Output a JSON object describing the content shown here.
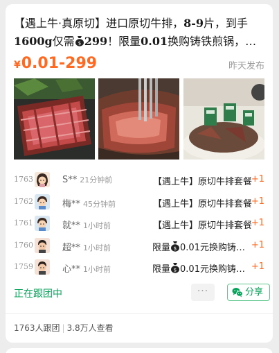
{
  "product": {
    "title_prefix": "【遇上牛·真原切】进口原切牛排，",
    "title_bold1": "8-9",
    "title_mid1": "片，到手",
    "title_bold2": "1600g",
    "title_mid2": "仅需",
    "title_bold3": "299",
    "title_mid3": "！限量",
    "title_bold4": "0.01",
    "title_suffix": "换购铸铁煎锅，…",
    "price_symbol": "¥",
    "price_range": "0.01-299",
    "posted": "昨天发布",
    "photos": [
      "steak-slices-photo",
      "steak-fork-photo",
      "steak-packages-photo"
    ]
  },
  "feed": [
    {
      "seq": "1763",
      "user": "S**",
      "time": "21分钟前",
      "item": "【遇上牛】原切牛排套餐",
      "qty": "+1",
      "avatar": "girl"
    },
    {
      "seq": "1762",
      "user": "梅**",
      "time": "45分钟前",
      "item": "【遇上牛】原切牛排套餐",
      "qty": "+1",
      "avatar": "boy"
    },
    {
      "seq": "1761",
      "user": "就**",
      "time": "1小时前",
      "item": "【遇上牛】原切牛排套餐",
      "qty": "+1",
      "avatar": "boy"
    },
    {
      "seq": "1760",
      "user": "超**",
      "time": "1小时前",
      "item_pre": "限量",
      "item": "0.01元换购铸铁煎锅",
      "qty": "+1",
      "avatar": "man"
    },
    {
      "seq": "1759",
      "user": "心**",
      "time": "1小时前",
      "item_pre": "限量",
      "item": "0.01元换购铸铁煎锅",
      "qty": "+1",
      "avatar": "man"
    }
  ],
  "actions": {
    "status": "正在跟团中",
    "more": "···",
    "share": "分享"
  },
  "stats": {
    "joined": "1763人跟团",
    "views": "3.8万人查看"
  },
  "colors": {
    "accent": "#ff6a22",
    "brand_green": "#07a35a"
  },
  "icons": [
    "money-bag-icon",
    "wechat-icon",
    "more-icon"
  ]
}
